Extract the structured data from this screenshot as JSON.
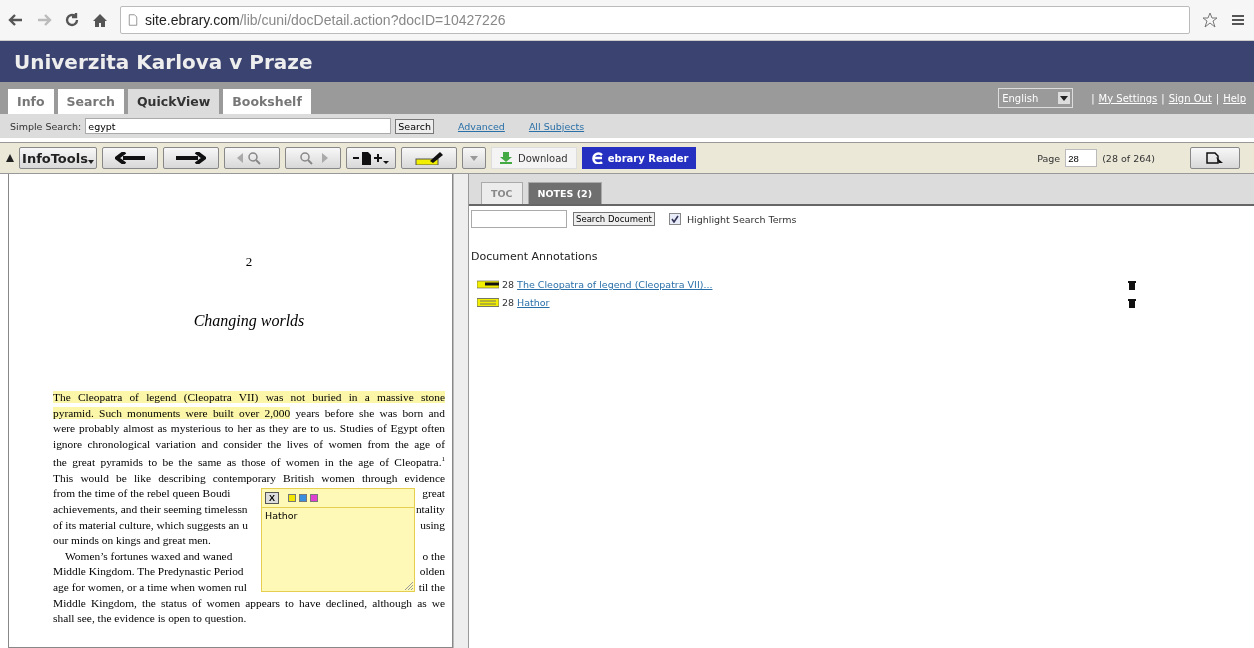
{
  "browser": {
    "url_host": "site.ebrary.com",
    "url_path": "/lib/cuni/docDetail.action?docID=10427226"
  },
  "header": {
    "title": "Univerzita Karlova v Praze"
  },
  "tabs": [
    {
      "label": "Info",
      "selected": false
    },
    {
      "label": "Search",
      "selected": false
    },
    {
      "label": "QuickView",
      "selected": true
    },
    {
      "label": "Bookshelf",
      "selected": false
    }
  ],
  "language": {
    "value": "English"
  },
  "account_links": [
    {
      "separator": "|",
      "label": "My Settings"
    },
    {
      "separator": "|",
      "label": "Sign Out"
    },
    {
      "separator": "|",
      "label": "Help"
    }
  ],
  "simple_search": {
    "label": "Simple Search:",
    "value": "egypt",
    "button": "Search",
    "links": [
      "Advanced",
      "All Subjects"
    ]
  },
  "toolbar": {
    "infotools": "InfoTools",
    "download": "Download",
    "reader": "ebrary Reader",
    "page_label": "Page",
    "page_value": "28",
    "page_count": "(28 of 264)"
  },
  "book": {
    "page_number": "2",
    "chapter_title": "Changing worlds",
    "lines": [
      {
        "parts": [
          {
            "text": "The Cleopatra of legend (Cleopatra VII) was not buried in a massive stone",
            "highlighted": true
          }
        ]
      },
      {
        "parts": [
          {
            "text": "pyramid. Such monuments were built over 2,000",
            "highlighted": true
          },
          {
            "text": " years before she was born and",
            "highlighted": false
          }
        ]
      },
      {
        "parts": [
          {
            "text": "were probably almost as mysterious to her as they are to us. Studies of Egypt often",
            "highlighted": false
          }
        ]
      },
      {
        "parts": [
          {
            "text": "ignore chronological variation and consider the lives of women from the age of",
            "highlighted": false
          }
        ]
      },
      {
        "parts": [
          {
            "text": "the great pyramids to be the same as those of women in the age of Cleopatra.$^{1}$",
            "highlighted": false
          }
        ]
      },
      {
        "parts": [
          {
            "text": "This would be like describing contemporary British women through evidence",
            "highlighted": false
          }
        ]
      },
      {
        "left": "from the time of the rebel queen Boudi",
        "right": "great"
      },
      {
        "left": "achievements, and their seeming timelessn",
        "right": "ntality"
      },
      {
        "left": "of its material culture, which suggests an u",
        "right": "using"
      },
      {
        "last": true,
        "parts": [
          {
            "text": "our minds on kings and great men.",
            "highlighted": false
          }
        ]
      },
      {
        "indent": true,
        "left": "Women’s fortunes waxed and waned",
        "right": "o the"
      },
      {
        "left": "Middle Kingdom. The Predynastic Period",
        "right": "olden"
      },
      {
        "left": "age for women, or a time when women rul",
        "right": "til the"
      },
      {
        "parts": [
          {
            "text": "Middle Kingdom, the status of women appears to have declined, although as we",
            "highlighted": false
          }
        ]
      },
      {
        "last": true,
        "parts": [
          {
            "text": "shall see, the evidence is open to question.",
            "highlighted": false
          }
        ]
      }
    ]
  },
  "note_popup": {
    "close": "X",
    "text": "Hathor",
    "swatches": [
      {
        "color": "#f2e600"
      },
      {
        "color": "#3a8ee0"
      },
      {
        "color": "#e040d0"
      }
    ]
  },
  "side_tabs": [
    {
      "label": "TOC",
      "selected": false
    },
    {
      "label": "NOTES (2)",
      "selected": true
    }
  ],
  "doc_search": {
    "button": "Search Document",
    "highlight_label": "Highlight Search Terms",
    "highlight_checked": true
  },
  "annotations": {
    "heading": "Document Annotations",
    "items": [
      {
        "kind": "highlight",
        "page": "28",
        "title": "The Cleopatra of legend (Cleopatra VII)..."
      },
      {
        "kind": "note",
        "page": "28",
        "title": "Hathor"
      }
    ]
  }
}
